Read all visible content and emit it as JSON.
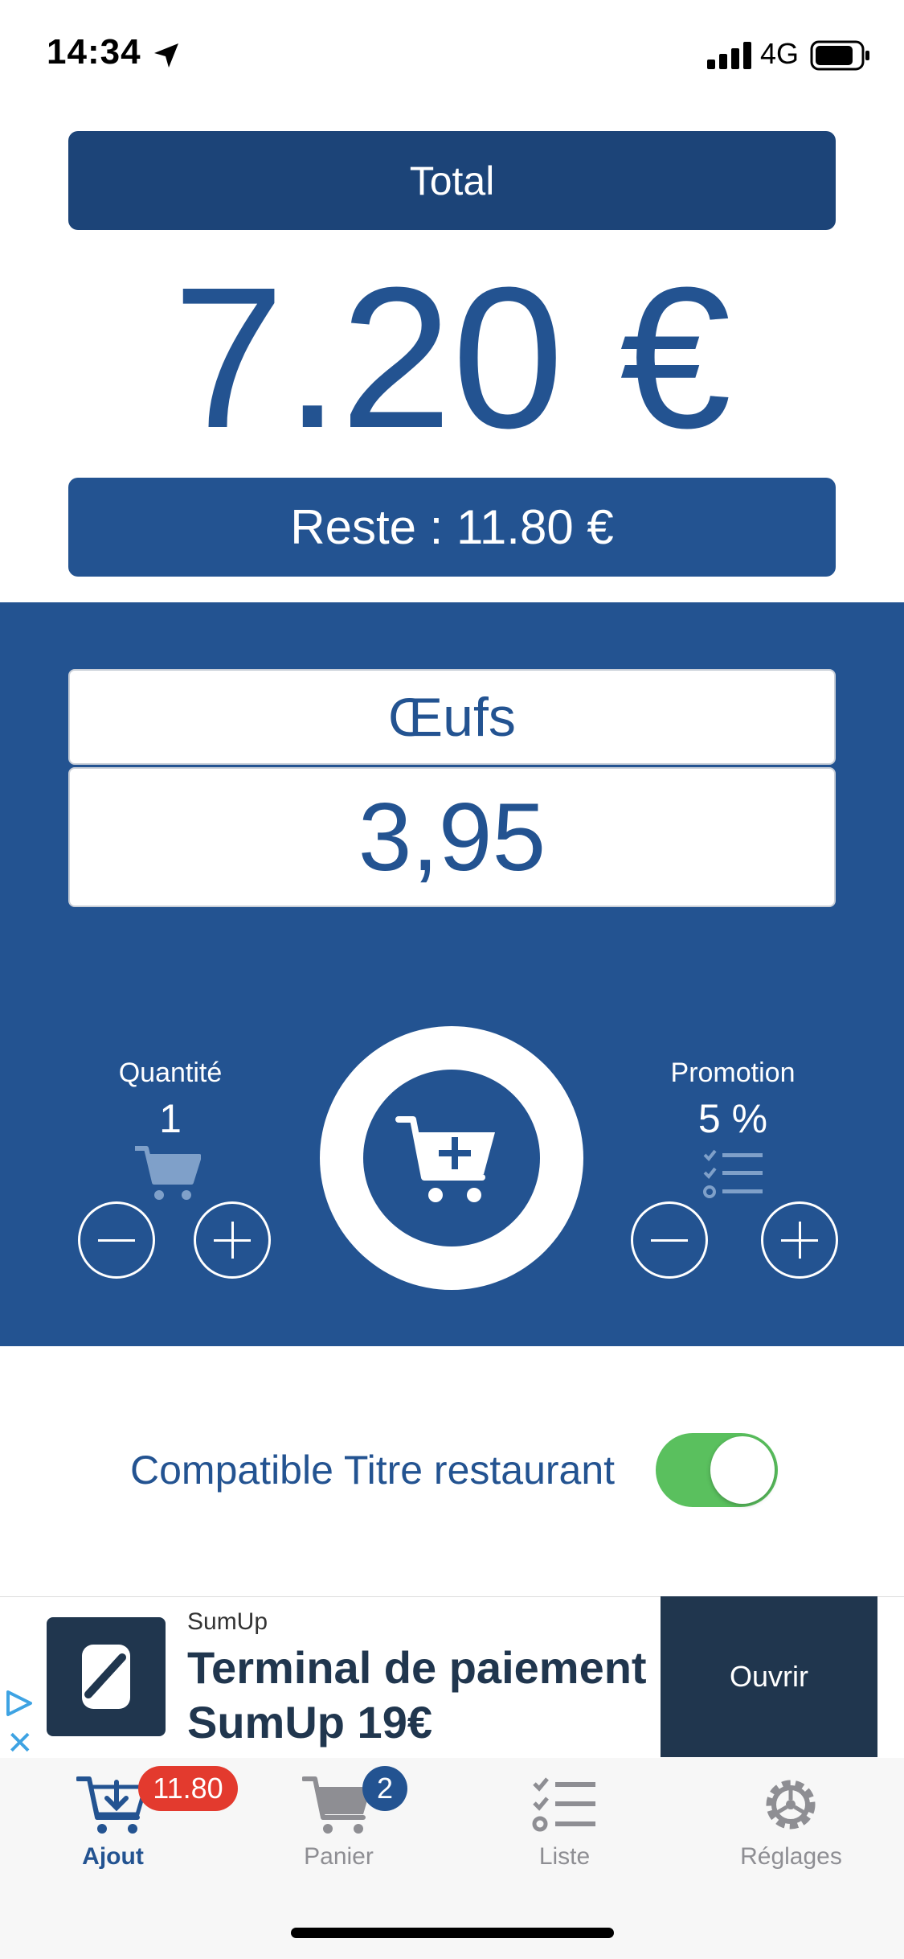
{
  "status_bar": {
    "time": "14:34",
    "network": "4G"
  },
  "summary": {
    "total_label": "Total",
    "total_amount": "7.20 €",
    "remaining": "Reste : 11.80 €"
  },
  "product": {
    "name": "Œufs",
    "price": "3,95"
  },
  "quantity": {
    "label": "Quantité",
    "value": "1"
  },
  "promotion": {
    "label": "Promotion",
    "value": "5 %"
  },
  "meal_voucher": {
    "label": "Compatible Titre restaurant",
    "enabled": true
  },
  "ad": {
    "advertiser": "SumUp",
    "headline": "Terminal de paiement SumUp 19€",
    "cta": "Ouvrir"
  },
  "tabs": [
    {
      "label": "Ajout",
      "badge": "11.80",
      "icon": "cart-add-icon",
      "active": true
    },
    {
      "label": "Panier",
      "badge": "2",
      "icon": "cart-icon",
      "active": false
    },
    {
      "label": "Liste",
      "badge": "",
      "icon": "checklist-icon",
      "active": false
    },
    {
      "label": "Réglages",
      "badge": "",
      "icon": "gear-icon",
      "active": false
    }
  ],
  "colors": {
    "primary": "#235391",
    "dark": "#1c4478",
    "toggle_on": "#5ac05e",
    "badge_red": "#e33a2e",
    "ad_dark": "#20364e"
  }
}
